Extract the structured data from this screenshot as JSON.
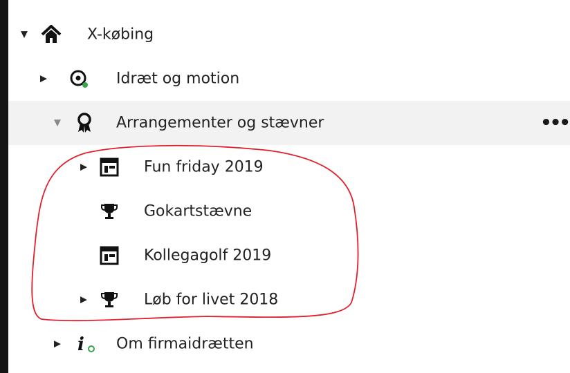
{
  "tree": {
    "root": {
      "label": "X-købing",
      "icon": "home-icon",
      "expanded": true
    },
    "items": [
      {
        "label": "Idræt og motion",
        "icon": "sport-target-icon",
        "expanded": false
      },
      {
        "label": "Arrangementer og stævner",
        "icon": "award-icon",
        "expanded": true,
        "more": "•••"
      },
      {
        "label": "Fun friday 2019",
        "icon": "calendar-page-icon",
        "expanded": false
      },
      {
        "label": "Gokartstævne",
        "icon": "trophy-icon"
      },
      {
        "label": "Kollegagolf 2019",
        "icon": "calendar-page-icon"
      },
      {
        "label": "Løb for livet 2018",
        "icon": "trophy-icon",
        "expanded": false
      },
      {
        "label": "Om firmaidrætten",
        "icon": "info-icon",
        "expanded": false
      }
    ]
  },
  "colors": {
    "highlight_row": "#f2f2f2",
    "annotation": "#e0202c",
    "status_green": "#3aa44a"
  }
}
